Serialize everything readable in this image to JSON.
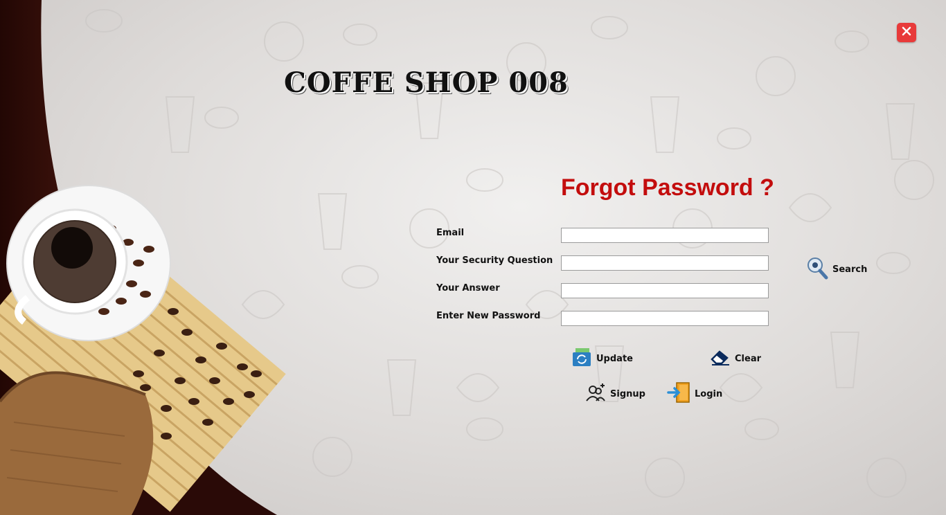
{
  "app": {
    "title": "COFFE SHOP 008"
  },
  "form": {
    "heading": "Forgot Password ?",
    "fields": [
      {
        "label": "Email",
        "value": "",
        "placeholder": ""
      },
      {
        "label": "Your Security Question",
        "value": "",
        "placeholder": ""
      },
      {
        "label": "Your Answer",
        "value": "",
        "placeholder": ""
      },
      {
        "label": "Enter New Password",
        "value": "",
        "placeholder": ""
      }
    ]
  },
  "buttons": {
    "search": "Search",
    "update": "Update",
    "clear": "Clear",
    "signup": "Signup",
    "login": "Login"
  },
  "icons": {
    "close": "close-icon",
    "search": "search-icon",
    "update": "update-icon",
    "clear": "eraser-icon",
    "signup": "add-user-icon",
    "login": "login-icon"
  },
  "colors": {
    "heading": "#c30d0d",
    "close_button": "#e83a3a",
    "dark_curve": "#2a0a07"
  }
}
